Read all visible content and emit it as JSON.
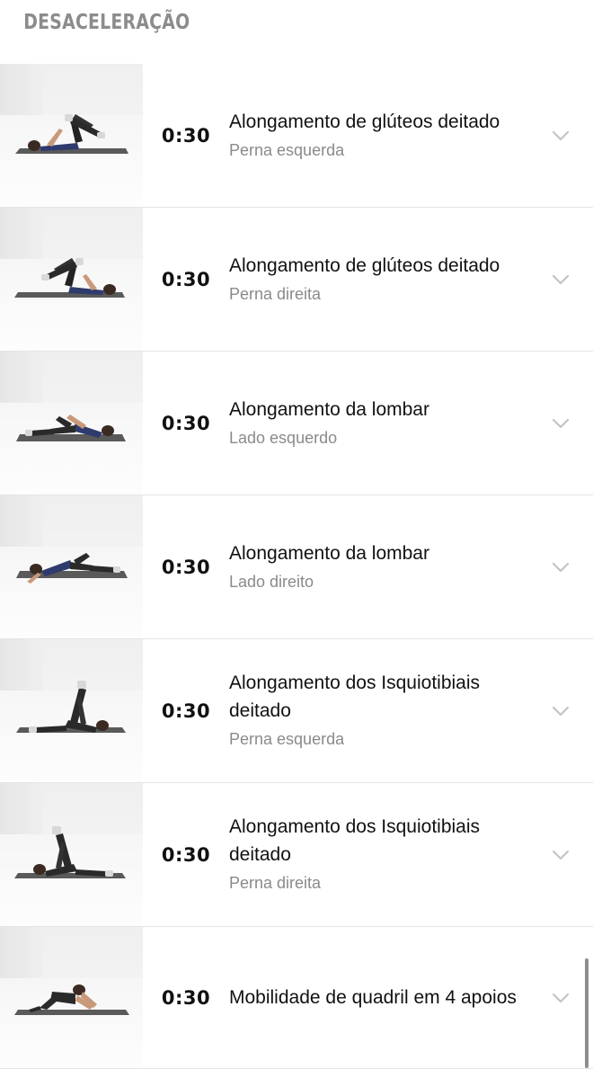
{
  "section": {
    "title": "DESACELERAÇÃO"
  },
  "exercises": [
    {
      "duration": "0:30",
      "title": "Alongamento de glúteos deitado",
      "subtitle": "Perna esquerda",
      "pose": "glute-left"
    },
    {
      "duration": "0:30",
      "title": "Alongamento de glúteos deitado",
      "subtitle": "Perna direita",
      "pose": "glute-right"
    },
    {
      "duration": "0:30",
      "title": "Alongamento da lombar",
      "subtitle": "Lado esquerdo",
      "pose": "lumbar-left"
    },
    {
      "duration": "0:30",
      "title": "Alongamento da lombar",
      "subtitle": "Lado direito",
      "pose": "lumbar-right"
    },
    {
      "duration": "0:30",
      "title": "Alongamento dos Isquiotibiais deitado",
      "subtitle": "Perna esquerda",
      "pose": "hamstring-left"
    },
    {
      "duration": "0:30",
      "title": "Alongamento dos Isquiotibiais deitado",
      "subtitle": "Perna direita",
      "pose": "hamstring-right"
    },
    {
      "duration": "0:30",
      "title": "Mobilidade de quadril em 4 apoios",
      "subtitle": "",
      "pose": "quadruped"
    }
  ],
  "icons": {
    "row_action": "chevron-down-icon"
  },
  "colors": {
    "text_primary": "#111111",
    "text_secondary": "#8a8a8a",
    "section_header": "#8c8c8c",
    "divider": "#e5e5e5"
  }
}
